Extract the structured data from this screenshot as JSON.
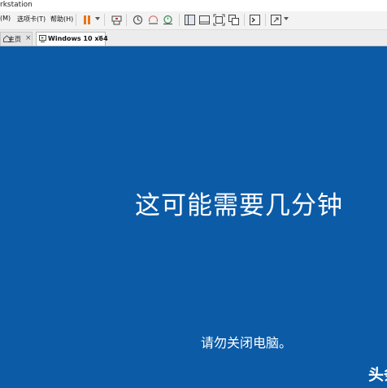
{
  "window": {
    "title": "rkstation"
  },
  "menu": {
    "items": [
      {
        "label": "(M)"
      },
      {
        "label": "选项卡(T)"
      },
      {
        "label": "帮助(H)"
      }
    ]
  },
  "toolbar": {
    "icons": [
      "pause-icon",
      "send-keys-icon",
      "snapshot-icon",
      "revert-snapshot-icon",
      "snapshot-manager-icon",
      "library-view-icon",
      "normal-view-icon",
      "fullscreen-icon",
      "unity-icon",
      "console-icon",
      "stretch-view-icon"
    ],
    "colors": {
      "pause": "#e8751a"
    }
  },
  "tabs": {
    "home_label": "主页",
    "vm_label": "Windows 10 x64",
    "close_glyph": "×"
  },
  "vm": {
    "heading": "这可能需要几分钟",
    "subtext": "请勿关闭电脑。",
    "background": "#0b5ba7"
  },
  "watermark": {
    "text": "头条"
  }
}
